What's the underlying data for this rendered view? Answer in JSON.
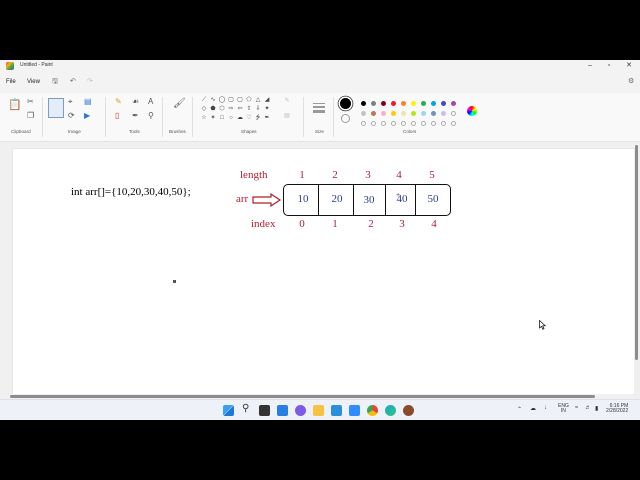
{
  "window": {
    "title": "Untitled - Paint"
  },
  "menu": {
    "file": "File",
    "view": "View"
  },
  "ribbon_groups": [
    "Clipboard",
    "Image",
    "Tools",
    "Brushes",
    "Shapes",
    "Size",
    "Colors"
  ],
  "canvas": {
    "code": "int arr[]={10,20,30,40,50};",
    "length_label": "length",
    "arr_label": "arr",
    "index_label": "index",
    "lengths": [
      "1",
      "2",
      "3",
      "4",
      "5"
    ],
    "values": [
      "10",
      "20",
      "30",
      "40",
      "50"
    ],
    "indices": [
      "0",
      "1",
      "2",
      "3",
      "4"
    ]
  },
  "colors": {
    "row1": [
      "#000000",
      "#7f7f7f",
      "#880015",
      "#ed1c24",
      "#ff7f27",
      "#fff200",
      "#22b14c",
      "#00a2e8",
      "#3f48cc",
      "#a349a4"
    ],
    "row2": [
      "#c3c3c3",
      "#b97a57",
      "#ffaec9",
      "#ffc90e",
      "#efe4b0",
      "#b5e61d",
      "#99d9ea",
      "#7092be",
      "#c8bfe7"
    ]
  },
  "taskbar": {
    "lang_top": "ENG",
    "lang_bottom": "IN",
    "time": "6:16 PM",
    "date": "2/28/2022"
  }
}
